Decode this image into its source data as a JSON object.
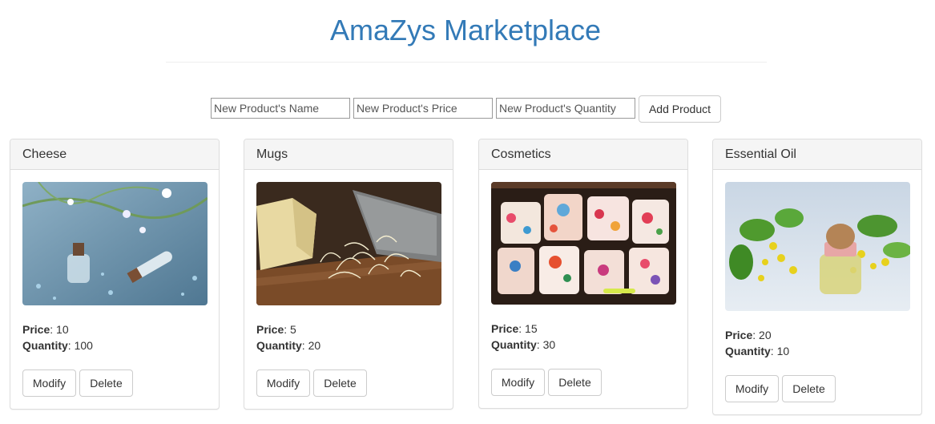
{
  "page": {
    "title": "AmaZys Marketplace"
  },
  "form": {
    "name_placeholder": "New Product's Name",
    "price_placeholder": "New Product's Price",
    "quantity_placeholder": "New Product's Quantity",
    "add_label": "Add Product"
  },
  "labels": {
    "price": "Price",
    "quantity": "Quantity",
    "modify": "Modify",
    "delete": "Delete"
  },
  "products": [
    {
      "name": "Cheese",
      "price": "10",
      "quantity": "100",
      "image": "essential-oil-bottles-photo"
    },
    {
      "name": "Mugs",
      "price": "5",
      "quantity": "20",
      "image": "grated-cheese-photo"
    },
    {
      "name": "Cosmetics",
      "price": "15",
      "quantity": "30",
      "image": "colorful-mugs-photo"
    },
    {
      "name": "Essential Oil",
      "price": "20",
      "quantity": "10",
      "image": "oil-bottle-flowers-photo"
    }
  ]
}
